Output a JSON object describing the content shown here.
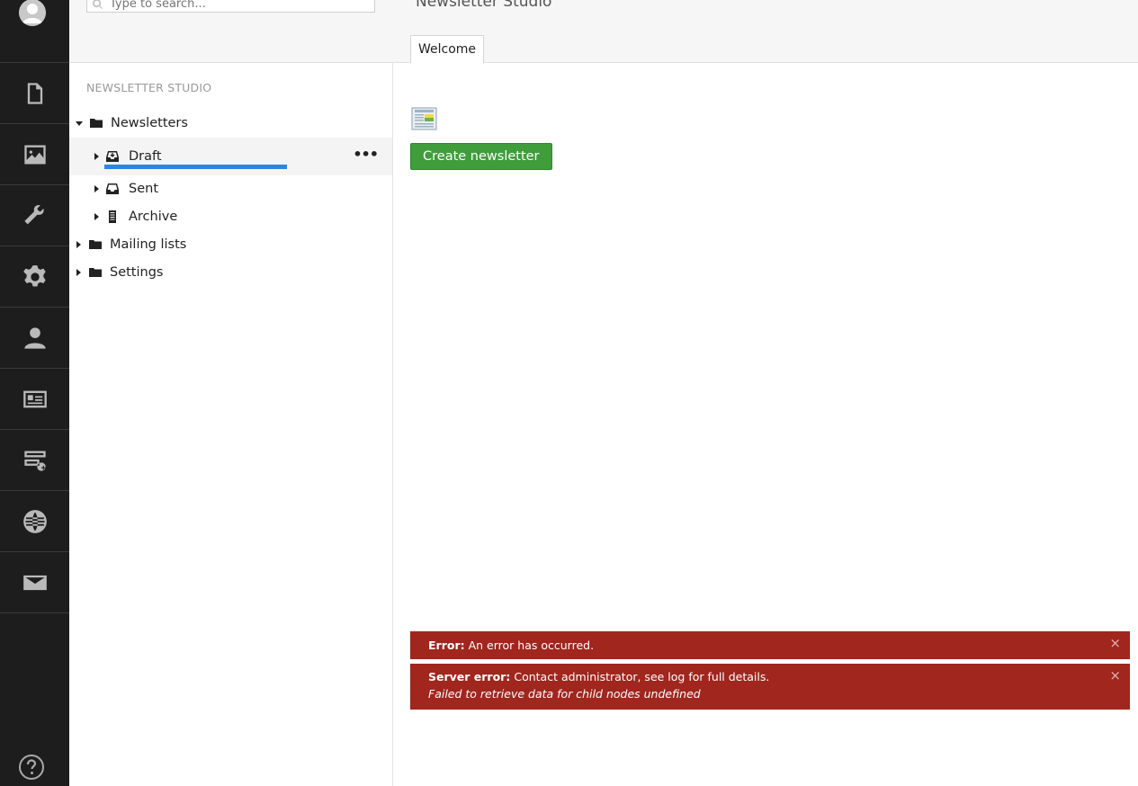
{
  "rail": {
    "items": [
      {
        "name": "content-icon"
      },
      {
        "name": "media-icon"
      },
      {
        "name": "settings-wrench-icon"
      },
      {
        "name": "gear-icon"
      },
      {
        "name": "users-icon"
      },
      {
        "name": "members-icon"
      },
      {
        "name": "forms-icon"
      },
      {
        "name": "translation-globe-icon"
      },
      {
        "name": "newsletter-mail-icon"
      }
    ],
    "help_icon": "help-icon"
  },
  "search": {
    "placeholder": "Type to search..."
  },
  "tree": {
    "section_title": "NEWSLETTER STUDIO",
    "nodes": [
      {
        "label": "Newsletters",
        "icon": "folder-icon",
        "expanded": true,
        "level": 0
      },
      {
        "label": "Draft",
        "icon": "inbox-icon",
        "expanded": false,
        "level": 1,
        "selected": true
      },
      {
        "label": "Sent",
        "icon": "inbox-icon",
        "expanded": false,
        "level": 1
      },
      {
        "label": "Archive",
        "icon": "archive-icon",
        "expanded": false,
        "level": 1
      },
      {
        "label": "Mailing lists",
        "icon": "folder-icon",
        "expanded": false,
        "level": 0
      },
      {
        "label": "Settings",
        "icon": "folder-icon",
        "expanded": false,
        "level": 0
      }
    ],
    "actions_label": "•••"
  },
  "main": {
    "title": "Newsletter Studio",
    "tabs": [
      {
        "label": "Welcome"
      }
    ],
    "create_button": "Create newsletter"
  },
  "notifications": [
    {
      "heading": "Error:",
      "message": "An error has occurred.",
      "close": "×"
    },
    {
      "heading": "Server error:",
      "message": "Contact administrator, see log for full details.",
      "detail": "Failed to retrieve data for child nodes undefined",
      "close": "×"
    }
  ],
  "colors": {
    "rail_bg": "#1d1d1d",
    "accent_loading": "#2a86e2",
    "button_green": "#3f9d3b",
    "error_bg": "#a0261e"
  }
}
